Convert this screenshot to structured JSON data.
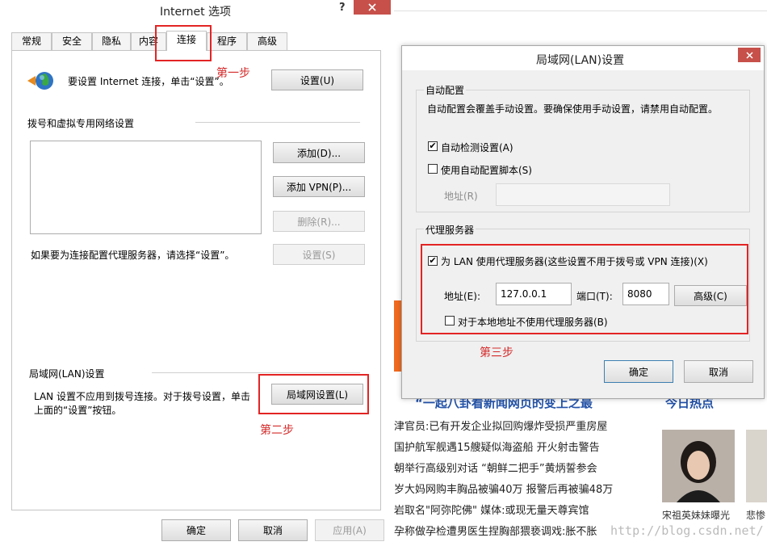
{
  "internet_options": {
    "title": "Internet 选项",
    "help_btn": "?",
    "tabs": [
      "常规",
      "安全",
      "隐私",
      "内容",
      "连接",
      "程序",
      "高级"
    ],
    "setup_text": "要设置 Internet 连接，单击“设置”。",
    "setup_button": "设置(U)",
    "dialup_group": "拨号和虚拟专用网络设置",
    "add_button": "添加(D)...",
    "add_vpn_button": "添加 VPN(P)...",
    "delete_button": "删除(R)...",
    "proxy_text": "如果要为连接配置代理服务器，请选择“设置”。",
    "settings_button": "设置(S)",
    "lan_group": "局域网(LAN)设置",
    "lan_text_1": "LAN 设置不应用到拨号连接。对于拨号设置，单击",
    "lan_text_2": "上面的“设置”按钮。",
    "lan_button": "局域网设置(L)",
    "ok_button": "确定",
    "cancel_button": "取消",
    "apply_button": "应用(A)"
  },
  "lan_dialog": {
    "title": "局域网(LAN)设置",
    "auto_group": "自动配置",
    "auto_desc": "自动配置会覆盖手动设置。要确保使用手动设置，请禁用自动配置。",
    "auto_detect_label": "自动检测设置(A)",
    "auto_detect_checked": true,
    "auto_script_label": "使用自动配置脚本(S)",
    "auto_script_checked": false,
    "address_label": "地址(R)",
    "proxy_group": "代理服务器",
    "use_proxy_label": "为 LAN 使用代理服务器(这些设置不用于拨号或 VPN 连接)(X)",
    "use_proxy_checked": true,
    "proxy_address_label": "地址(E):",
    "proxy_address_value": "127.0.0.1",
    "port_label": "端口(T):",
    "port_value": "8080",
    "advanced_button": "高级(C)",
    "bypass_label": "对于本地地址不使用代理服务器(B)",
    "bypass_checked": false,
    "ok_button": "确定",
    "cancel_button": "取消"
  },
  "annotations": {
    "step1": "第一步",
    "step2": "第二步",
    "step3": "第三步",
    "color": "#e32424"
  },
  "background_page": {
    "headline": "“一起八卦看新闻网页的变上之最",
    "section_title": "今日热点",
    "news": [
      "津官员:已有开发企业拟回购爆炸受损严重房屋",
      "国护航军舰遇15艘疑似海盗船 开火射击警告",
      "朝举行高级别对话 “朝鲜二把手”黄炳誓参会",
      "岁大妈网购丰胸品被骗40万 报警后再被骗48万",
      "岩取名\"阿弥陀佛\" 媒体:或现无量天尊宾馆",
      "孕称做孕检遭男医生捏胸部猥亵调戏:胀不胀"
    ],
    "photo_caption_1": "宋祖英妹妹曝光",
    "photo_caption_2": "悲惨",
    "watermark": "http://blog.csdn.net/"
  }
}
